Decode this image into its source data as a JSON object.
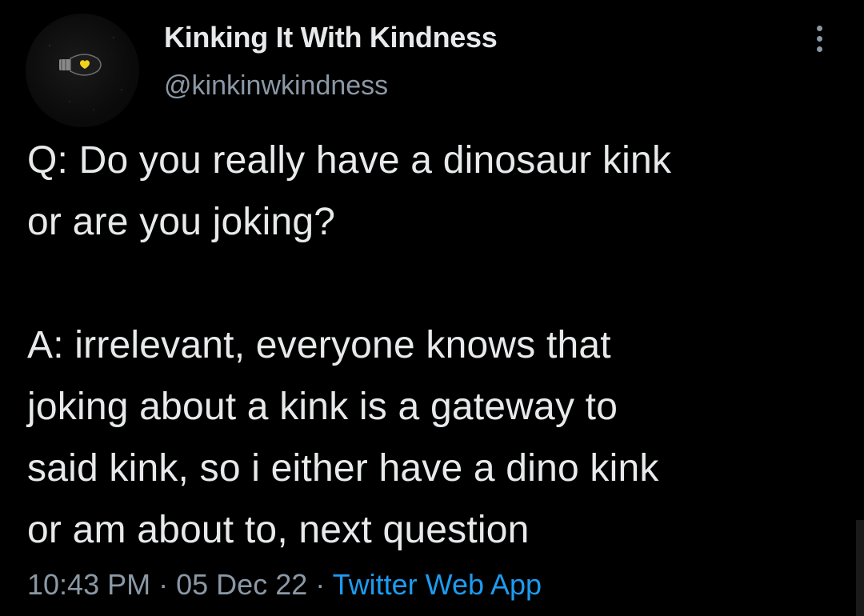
{
  "author": {
    "display_name": "Kinking It With Kindness",
    "handle": "@kinkinwkindness",
    "avatar_icon": "lightbulb-heart-icon"
  },
  "menu": {
    "icon": "more-vertical-icon"
  },
  "tweet": {
    "lines": [
      "Q: Do you really have a dinosaur kink",
      "or are you joking?",
      "",
      "A: irrelevant, everyone knows that",
      "joking about a kink is a gateway to",
      "said kink, so i either have a dino kink",
      "or am about to, next question"
    ],
    "time": "10:43 PM",
    "separator": "·",
    "date": "05 Dec 22",
    "source": "Twitter Web App"
  },
  "colors": {
    "background": "#000000",
    "text": "#e7e9ea",
    "secondary": "#8b98a5",
    "link": "#1d9bf0"
  }
}
